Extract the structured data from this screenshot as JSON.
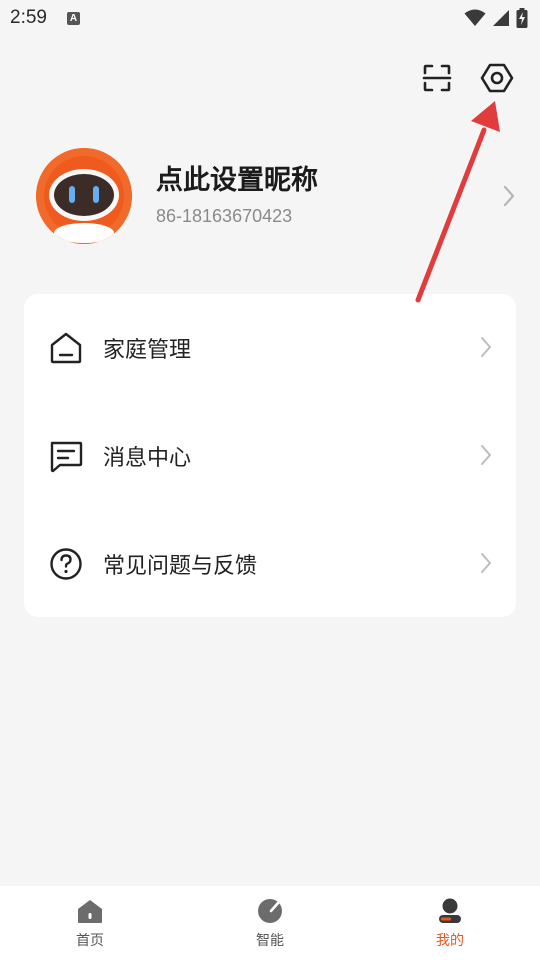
{
  "status_bar": {
    "time": "2:59",
    "notification_badge": "A"
  },
  "header": {
    "scan_icon": "scan-icon",
    "settings_icon": "hexagon-settings-icon"
  },
  "profile": {
    "nickname": "点此设置昵称",
    "phone": "86-18163670423",
    "avatar_color": "#f26a2a"
  },
  "menu": {
    "items": [
      {
        "label": "家庭管理",
        "icon": "home-icon"
      },
      {
        "label": "消息中心",
        "icon": "message-icon"
      },
      {
        "label": "常见问题与反馈",
        "icon": "question-icon"
      }
    ]
  },
  "tab_bar": {
    "tabs": [
      {
        "label": "首页",
        "icon": "home-tab-icon",
        "active": false
      },
      {
        "label": "智能",
        "icon": "smart-tab-icon",
        "active": false
      },
      {
        "label": "我的",
        "icon": "me-tab-icon",
        "active": true
      }
    ]
  },
  "colors": {
    "accent": "#f0541f",
    "annotation_arrow": "#e23b3b",
    "background": "#f5f5f6"
  }
}
